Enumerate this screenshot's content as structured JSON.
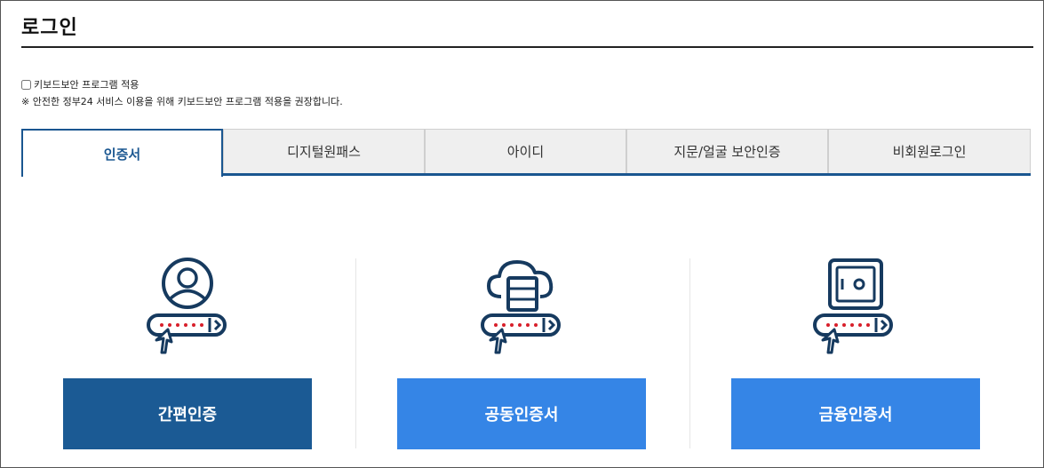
{
  "page": {
    "title": "로그인"
  },
  "security": {
    "checkbox_label": "키보드보안 프로그램 적용",
    "notice": "※ 안전한 정부24 서비스 이용을 위해 키보드보안 프로그램 적용을 권장합니다."
  },
  "tabs": [
    {
      "label": "인증서",
      "active": true
    },
    {
      "label": "디지털원패스",
      "active": false
    },
    {
      "label": "아이디",
      "active": false
    },
    {
      "label": "지문/얼굴 보안인증",
      "active": false
    },
    {
      "label": "비회원로그인",
      "active": false
    }
  ],
  "cards": [
    {
      "icon": "user-circle-icon",
      "button_label": "간편인증",
      "button_color": "#1b5a94"
    },
    {
      "icon": "cloud-server-icon",
      "button_label": "공동인증서",
      "button_color": "#3585e6"
    },
    {
      "icon": "safe-vault-icon",
      "button_label": "금융인증서",
      "button_color": "#3585e6"
    }
  ],
  "colors": {
    "primary_dark": "#1b5a94",
    "primary_light": "#3585e6",
    "icon_navy": "#163a5f",
    "password_dot_red": "#d81f2a"
  }
}
